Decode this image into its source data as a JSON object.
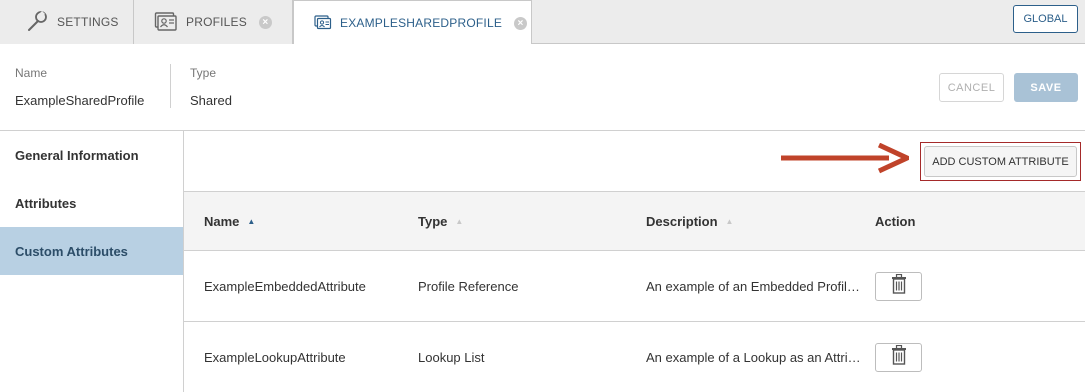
{
  "tabs": [
    {
      "label": "SETTINGS",
      "icon": "wrench-icon"
    },
    {
      "label": "PROFILES",
      "icon": "profiles-icon",
      "closable": true
    },
    {
      "label": "EXAMPLESHAREDPROFILE",
      "icon": "profile-icon",
      "closable": true,
      "active": true
    }
  ],
  "global_label": "GLOBAL",
  "header": {
    "name_label": "Name",
    "name_value": "ExampleSharedProfile",
    "type_label": "Type",
    "type_value": "Shared",
    "cancel_label": "CANCEL",
    "save_label": "SAVE"
  },
  "sidebar": {
    "items": [
      {
        "label": "General Information"
      },
      {
        "label": "Attributes"
      },
      {
        "label": "Custom Attributes",
        "active": true
      }
    ]
  },
  "toolbar": {
    "add_label": "ADD CUSTOM ATTRIBUTE"
  },
  "table": {
    "columns": [
      "Name",
      "Type",
      "Description",
      "Action"
    ],
    "rows": [
      {
        "name": "ExampleEmbeddedAttribute",
        "type": "Profile Reference",
        "description": "An example of an Embedded Profile reference"
      },
      {
        "name": "ExampleLookupAttribute",
        "type": "Lookup List",
        "description": "An example of a Lookup as an Attribute"
      }
    ]
  },
  "colors": {
    "accent": "#2c5f8a",
    "sidebar_active": "#b8d0e3",
    "save_disabled": "#a9c2d6",
    "annotation": "#c0432a"
  }
}
